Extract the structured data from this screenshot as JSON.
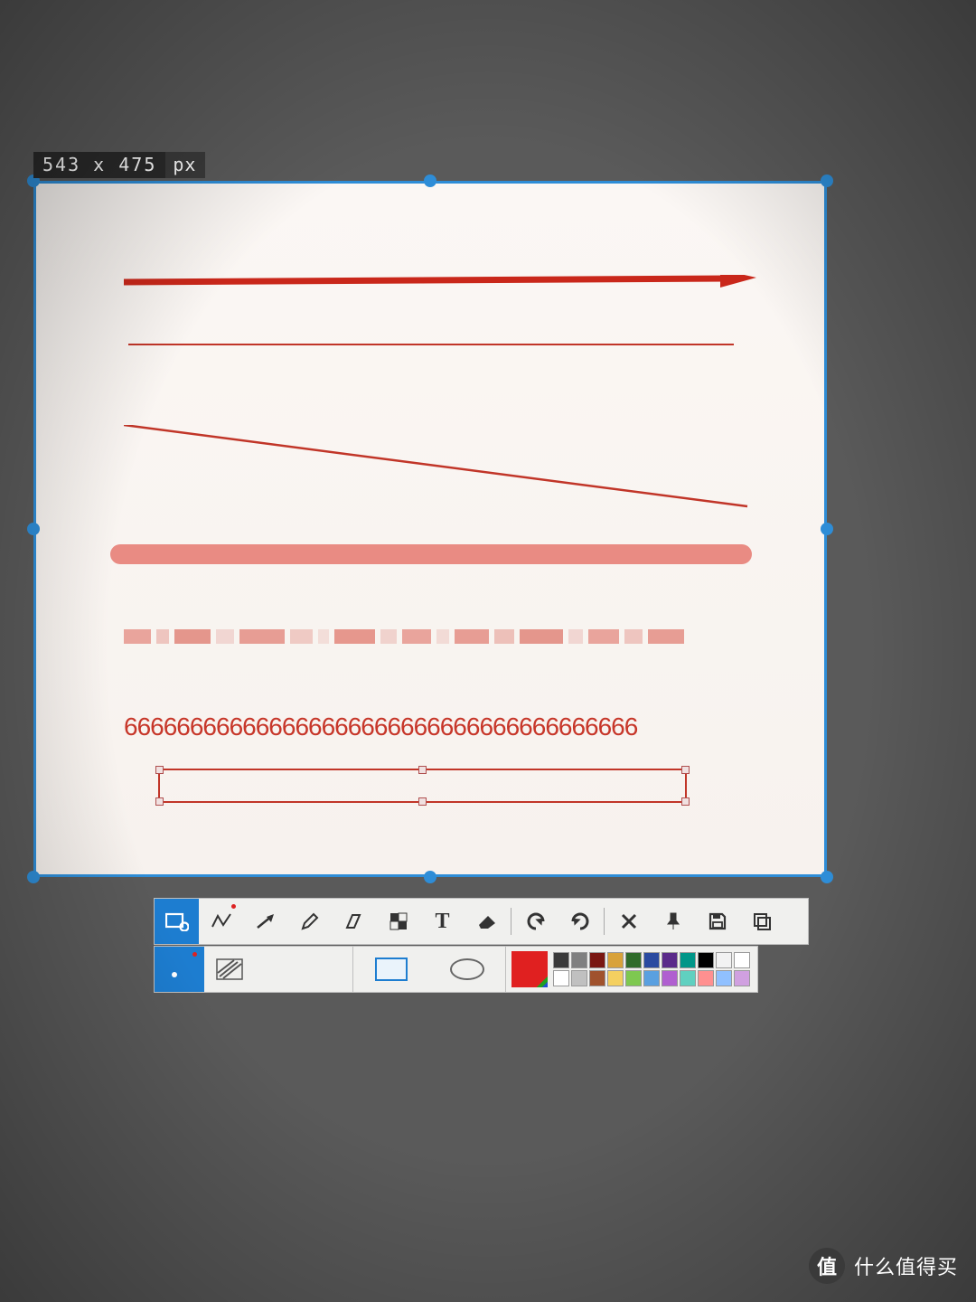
{
  "size_tip": {
    "dimensions": "543 x 475",
    "unit": "px"
  },
  "canvas": {
    "text_content": "666666666666666666666666666666666666666"
  },
  "toolbar": {
    "items": [
      {
        "name": "rect-select-tool",
        "active": true
      },
      {
        "name": "polyline-tool",
        "dot": true
      },
      {
        "name": "arrow-tool"
      },
      {
        "name": "pencil-tool"
      },
      {
        "name": "highlighter-tool"
      },
      {
        "name": "mosaic-tool"
      },
      {
        "name": "text-tool",
        "label": "T"
      },
      {
        "name": "eraser-tool"
      },
      {
        "name": "sep"
      },
      {
        "name": "undo-button"
      },
      {
        "name": "redo-button"
      },
      {
        "name": "sep"
      },
      {
        "name": "close-button"
      },
      {
        "name": "pin-button"
      },
      {
        "name": "save-button"
      },
      {
        "name": "copy-button"
      }
    ]
  },
  "subbar": {
    "size_dots": [
      {
        "name": "size-small",
        "active": true,
        "dot": true
      },
      {
        "name": "size-hatch"
      }
    ],
    "shapes": [
      {
        "name": "shape-rectangle",
        "active": true
      },
      {
        "name": "shape-ellipse"
      }
    ]
  },
  "palette": {
    "current": "#e02020",
    "row1": [
      "#3a3a3a",
      "#808080",
      "#7a1712",
      "#d8a23a",
      "#2f6b2a",
      "#2a4aa0",
      "#5a2a8a",
      "#009688",
      "#000000",
      "#f2f2f2",
      "#ffffff"
    ],
    "row2": [
      "#ffffff",
      "#c0c0c0",
      "#a0522d",
      "#f4d060",
      "#7ec850",
      "#5aa0e0",
      "#b060d0",
      "#60d0c0",
      "#ff9090",
      "#90c0ff",
      "#d0a0e0"
    ]
  },
  "watermark": {
    "badge": "值",
    "text": "什么值得买"
  }
}
